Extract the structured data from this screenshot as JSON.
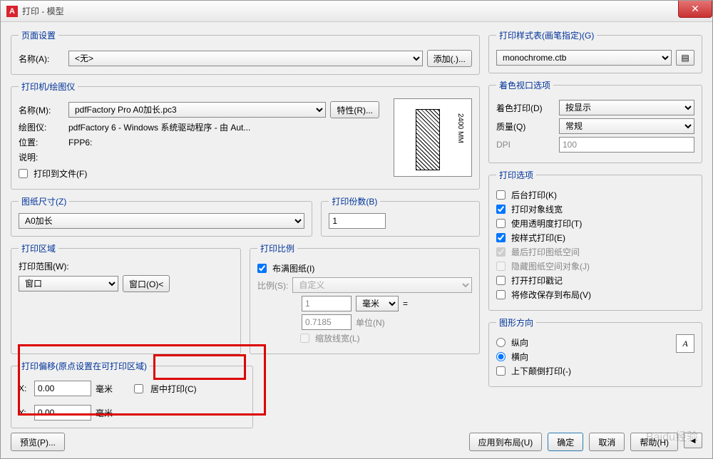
{
  "window": {
    "title": "打印 - 模型"
  },
  "page_setup": {
    "legend": "页面设置",
    "name_label": "名称(A):",
    "name_value": "<无>",
    "add_btn": "添加(.)..."
  },
  "plot_style": {
    "legend": "打印样式表(画笔指定)(G)",
    "value": "monochrome.ctb"
  },
  "printer": {
    "legend": "打印机/绘图仪",
    "name_label": "名称(M):",
    "name_value": "pdfFactory Pro A0加长.pc3",
    "properties_btn": "特性(R)...",
    "plotter_label": "绘图仪:",
    "plotter_value": "pdfFactory 6 - Windows 系统驱动程序 - 由 Aut...",
    "location_label": "位置:",
    "location_value": "FPP6:",
    "desc_label": "说明:",
    "desc_value": "",
    "print_to_file": "打印到文件(F)",
    "preview_dim": "2400 MM"
  },
  "shading": {
    "legend": "着色视口选项",
    "shade_label": "着色打印(D)",
    "shade_value": "按显示",
    "quality_label": "质量(Q)",
    "quality_value": "常规",
    "dpi_label": "DPI",
    "dpi_value": "100"
  },
  "paper_size": {
    "legend": "图纸尺寸(Z)",
    "value": "A0加长"
  },
  "copies": {
    "legend": "打印份数(B)",
    "value": "1"
  },
  "options": {
    "legend": "打印选项",
    "bg": "后台打印(K)",
    "lw": "打印对象线宽",
    "trans": "使用透明度打印(T)",
    "style": "按样式打印(E)",
    "paper_last": "最后打印图纸空间",
    "hide": "隐藏图纸空间对象(J)",
    "stamp": "打开打印戳记",
    "save": "将修改保存到布局(V)"
  },
  "area": {
    "legend": "打印区域",
    "range_label": "打印范围(W):",
    "range_value": "窗口",
    "window_btn": "窗口(O)<"
  },
  "scale": {
    "legend": "打印比例",
    "fit": "布满图纸(I)",
    "ratio_label": "比例(S):",
    "ratio_value": "自定义",
    "num": "1",
    "unit1": "毫米",
    "equals": "=",
    "den": "0.7185",
    "unit2_label": "单位(N)",
    "scale_lw": "缩放线宽(L)"
  },
  "offset": {
    "legend": "打印偏移(原点设置在可打印区域)",
    "x_label": "X:",
    "x_value": "0.00",
    "y_label": "Y:",
    "y_value": "0.00",
    "unit": "毫米",
    "center": "居中打印(C)"
  },
  "orientation": {
    "legend": "图形方向",
    "portrait": "纵向",
    "landscape": "横向",
    "upside": "上下颠倒打印(-)",
    "icon": "A"
  },
  "footer": {
    "preview": "预览(P)...",
    "apply": "应用到布局(U)",
    "ok": "确定",
    "cancel": "取消",
    "help": "帮助(H)"
  },
  "watermark": "Baidu经验"
}
